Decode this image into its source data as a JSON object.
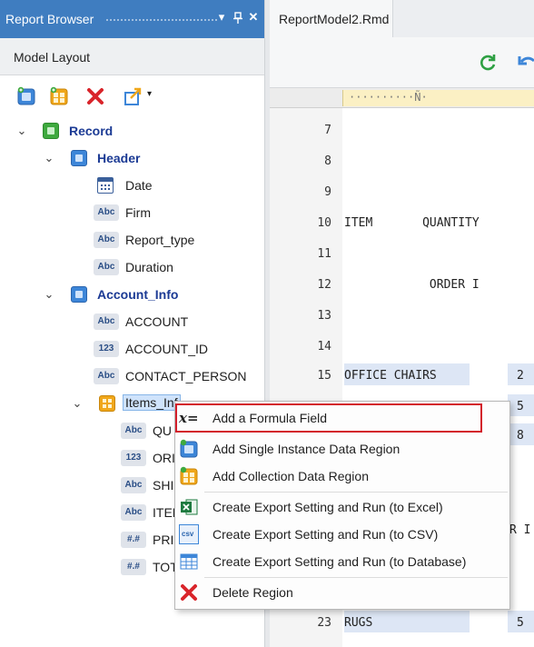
{
  "left_pane": {
    "title": "Report Browser",
    "title_buttons": {
      "dropdown": "▾",
      "pin": "ᵖ",
      "close": "✕"
    },
    "section_title": "Model Layout"
  },
  "tree": {
    "record": "Record",
    "header": "Header",
    "header_fields": [
      {
        "type": "date",
        "label": "Date"
      },
      {
        "type": "Abc",
        "label": "Firm"
      },
      {
        "type": "Abc",
        "label": "Report_type"
      },
      {
        "type": "Abc",
        "label": "Duration"
      }
    ],
    "account_info": "Account_Info",
    "account_fields": [
      {
        "type": "Abc",
        "label": "ACCOUNT"
      },
      {
        "type": "123",
        "label": "ACCOUNT_ID"
      },
      {
        "type": "Abc",
        "label": "CONTACT_PERSON"
      }
    ],
    "items_info": "Items_Inf",
    "items_fields": [
      {
        "type": "Abc",
        "label": "QU"
      },
      {
        "type": "123",
        "label": "ORI"
      },
      {
        "type": "Abc",
        "label": "SHI"
      },
      {
        "type": "Abc",
        "label": "ITEN"
      },
      {
        "type": "#.#",
        "label": "PRI"
      },
      {
        "type": "#.#",
        "label": "TOT"
      }
    ]
  },
  "editor": {
    "tab_title": "ReportModel2.Rmd",
    "ruler_text": "··········Ñ·",
    "lines": [
      {
        "num": "7",
        "text": ""
      },
      {
        "num": "8",
        "text": ""
      },
      {
        "num": "9",
        "text": ""
      },
      {
        "num": "10",
        "text": "ITEM       QUANTITY"
      },
      {
        "num": "11",
        "text": ""
      },
      {
        "num": "12",
        "text": "            ORDER I"
      },
      {
        "num": "13",
        "text": ""
      },
      {
        "num": "14",
        "text": ""
      },
      {
        "num": "15",
        "text": "OFFICE CHAIRS"
      },
      {
        "num": "23",
        "text": "RUGS"
      }
    ],
    "value_15": "2",
    "value_16": "5",
    "value_17": "8",
    "partial_right": "R I",
    "value_23": "5"
  },
  "context_menu": {
    "items": [
      {
        "label": "Add a Formula Field",
        "icon": "formula-icon"
      },
      {
        "label": "Add Single Instance Data Region",
        "icon": "single-region-icon"
      },
      {
        "label": "Add Collection Data Region",
        "icon": "collection-region-icon"
      },
      {
        "label": "Create Export Setting and Run (to Excel)",
        "icon": "excel-icon"
      },
      {
        "label": "Create Export Setting and Run (to CSV)",
        "icon": "csv-icon"
      },
      {
        "label": "Create Export Setting and Run (to Database)",
        "icon": "database-icon"
      },
      {
        "label": "Delete Region",
        "icon": "delete-icon"
      }
    ],
    "formula_glyph": "x=",
    "csv_glyph": "csv"
  },
  "colors": {
    "title_bar": "#3f7dc0",
    "highlight_border": "#d3202b",
    "selection": "#cfe3fb",
    "delete_red": "#d9252b"
  }
}
